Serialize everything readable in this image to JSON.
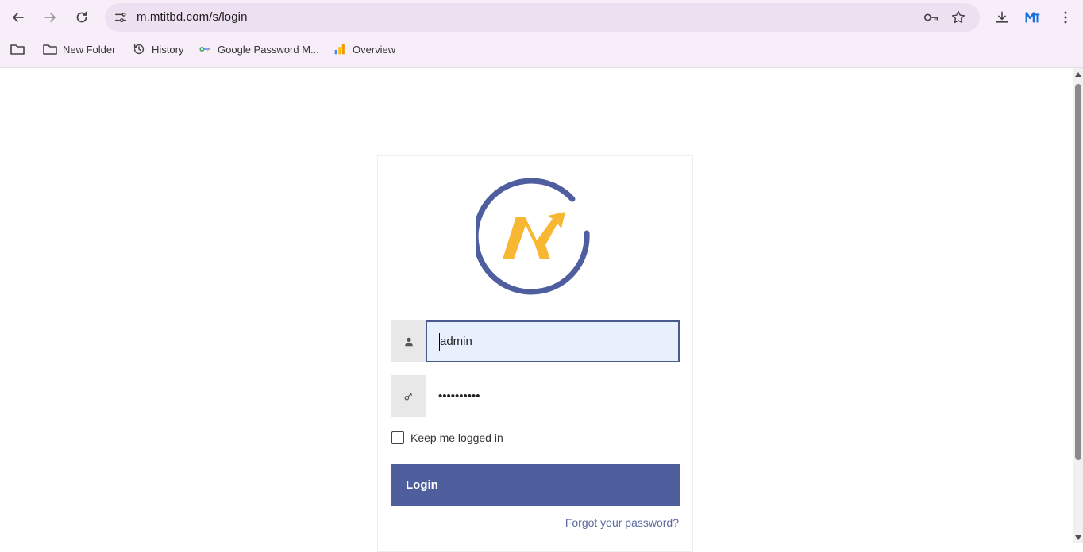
{
  "browser": {
    "url": "m.mtitbd.com/s/login",
    "profile_initials": "M"
  },
  "bookmarks": [
    {
      "label": "",
      "icon": "folder-icon"
    },
    {
      "label": "New Folder",
      "icon": "folder-icon"
    },
    {
      "label": "History",
      "icon": "history-icon"
    },
    {
      "label": "Google Password M...",
      "icon": "password-key-icon"
    },
    {
      "label": "Overview",
      "icon": "analytics-icon"
    }
  ],
  "login": {
    "username_value": "admin",
    "password_value": "••••••••••",
    "remember_label": "Keep me logged in",
    "remember_checked": false,
    "login_label": "Login",
    "forgot_label": "Forgot your password?"
  },
  "colors": {
    "brand_primary": "#4f5f9e",
    "logo_accent": "#f7b733",
    "chrome_bg": "#f8eefa"
  }
}
